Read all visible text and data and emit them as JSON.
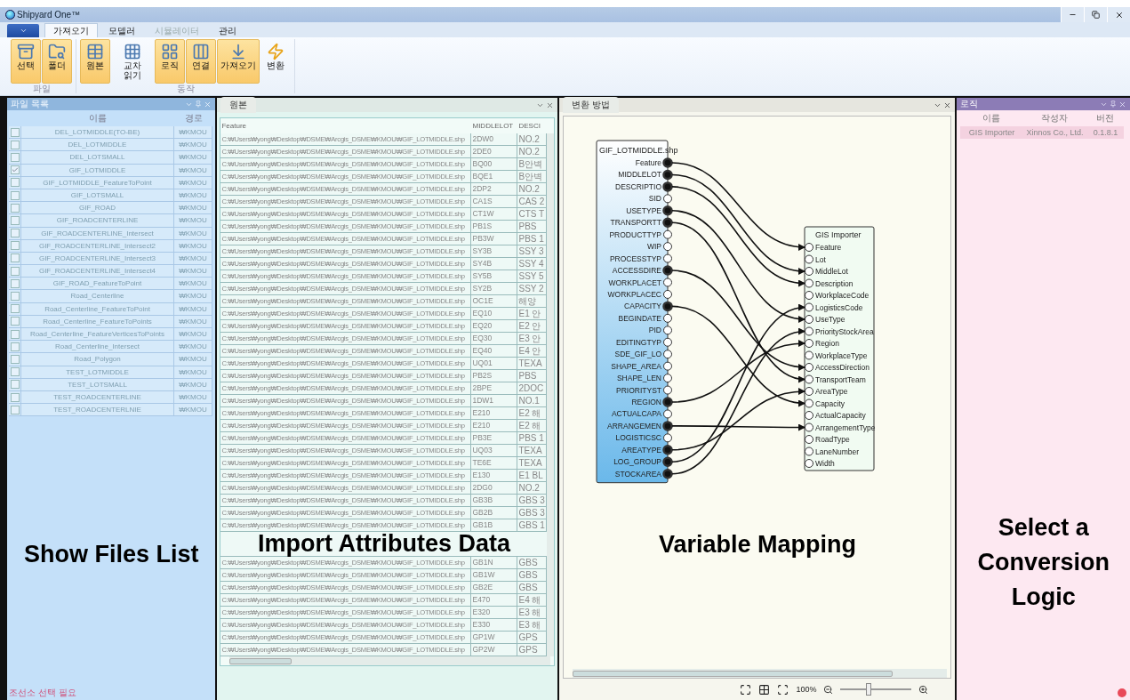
{
  "window": {
    "title": "Shipyard One™"
  },
  "tabs": [
    {
      "label": "가져오기",
      "selected": true,
      "disabled": false
    },
    {
      "label": "모델러",
      "selected": false,
      "disabled": false
    },
    {
      "label": "시뮬레이터",
      "selected": false,
      "disabled": true
    },
    {
      "label": "관리",
      "selected": false,
      "disabled": false
    }
  ],
  "ribbon": {
    "groups": [
      {
        "label": "파일",
        "buttons": [
          {
            "label": "선택",
            "active": true
          },
          {
            "label": "폴더",
            "active": true
          }
        ]
      },
      {
        "label": "동작",
        "buttons": [
          {
            "label": "원본",
            "active": true
          },
          {
            "label": "교차\n읽기",
            "active": false
          },
          {
            "label": "로직",
            "active": true
          },
          {
            "label": "연결",
            "active": true
          },
          {
            "label": "가져오기",
            "active": true
          },
          {
            "label": "변환",
            "active": false
          }
        ]
      }
    ]
  },
  "files_panel": {
    "title": "파일 목록",
    "columns": [
      "이름",
      "경로"
    ],
    "annotation": "Show Files List",
    "status": "조선소 선택 필요",
    "rows": [
      {
        "name": "DEL_LOTMIDDLE(TO-BE)",
        "path": "₩KMOU",
        "checked": false
      },
      {
        "name": "DEL_LOTMIDDLE",
        "path": "₩KMOU",
        "checked": false
      },
      {
        "name": "DEL_LOTSMALL",
        "path": "₩KMOU",
        "checked": false
      },
      {
        "name": "GIF_LOTMIDDLE",
        "path": "₩KMOU",
        "checked": true
      },
      {
        "name": "GIF_LOTMIDDLE_FeatureToPoint",
        "path": "₩KMOU",
        "checked": false
      },
      {
        "name": "GIF_LOTSMALL",
        "path": "₩KMOU",
        "checked": false
      },
      {
        "name": "GIF_ROAD",
        "path": "₩KMOU",
        "checked": false
      },
      {
        "name": "GIF_ROADCENTERLINE",
        "path": "₩KMOU",
        "checked": false
      },
      {
        "name": "GIF_ROADCENTERLINE_Intersect",
        "path": "₩KMOU",
        "checked": false
      },
      {
        "name": "GIF_ROADCENTERLINE_Intersect2",
        "path": "₩KMOU",
        "checked": false
      },
      {
        "name": "GIF_ROADCENTERLINE_Intersect3",
        "path": "₩KMOU",
        "checked": false
      },
      {
        "name": "GIF_ROADCENTERLINE_Intersect4",
        "path": "₩KMOU",
        "checked": false
      },
      {
        "name": "GIF_ROAD_FeatureToPoint",
        "path": "₩KMOU",
        "checked": false
      },
      {
        "name": "Road_Centerline",
        "path": "₩KMOU",
        "checked": false
      },
      {
        "name": "Road_Centerline_FeatureToPoint",
        "path": "₩KMOU",
        "checked": false
      },
      {
        "name": "Road_Centerline_FeatureToPoints",
        "path": "₩KMOU",
        "checked": false
      },
      {
        "name": "Road_Centerline_FeatureVerticesToPoints",
        "path": "₩KMOU",
        "checked": false
      },
      {
        "name": "Road_Centerline_Intersect",
        "path": "₩KMOU",
        "checked": false
      },
      {
        "name": "Road_Polygon",
        "path": "₩KMOU",
        "checked": false
      },
      {
        "name": "TEST_LOTMIDDLE",
        "path": "₩KMOU",
        "checked": false
      },
      {
        "name": "TEST_LOTSMALL",
        "path": "₩KMOU",
        "checked": false
      },
      {
        "name": "TEST_ROADCENTERLINE",
        "path": "₩KMOU",
        "checked": false
      },
      {
        "name": "TEST_ROADCENTERLNIE",
        "path": "₩KMOU",
        "checked": false
      }
    ]
  },
  "source_panel": {
    "title": "원본",
    "columns": [
      "Feature",
      "MIDDLELOT",
      "DESCI"
    ],
    "rows": [
      {
        "kind": "row",
        "cells": [
          "C:₩Users₩yong₩Desktop₩DSME₩Arcgis_DSME₩KMOU₩GIF_LOTMIDDLE.shp",
          "2DW0",
          "NO.2"
        ]
      },
      {
        "kind": "row",
        "cells": [
          "C:₩Users₩yong₩Desktop₩DSME₩Arcgis_DSME₩KMOU₩GIF_LOTMIDDLE.shp",
          "2DE0",
          "NO.2"
        ]
      },
      {
        "kind": "row",
        "cells": [
          "C:₩Users₩yong₩Desktop₩DSME₩Arcgis_DSME₩KMOU₩GIF_LOTMIDDLE.shp",
          "BQ00",
          "B안벽"
        ]
      },
      {
        "kind": "row",
        "cells": [
          "C:₩Users₩yong₩Desktop₩DSME₩Arcgis_DSME₩KMOU₩GIF_LOTMIDDLE.shp",
          "BQE1",
          "B안벽"
        ]
      },
      {
        "kind": "row",
        "cells": [
          "C:₩Users₩yong₩Desktop₩DSME₩Arcgis_DSME₩KMOU₩GIF_LOTMIDDLE.shp",
          "2DP2",
          "NO.2"
        ]
      },
      {
        "kind": "row",
        "cells": [
          "C:₩Users₩yong₩Desktop₩DSME₩Arcgis_DSME₩KMOU₩GIF_LOTMIDDLE.shp",
          "CA1S",
          "CAS 2"
        ]
      },
      {
        "kind": "row",
        "cells": [
          "C:₩Users₩yong₩Desktop₩DSME₩Arcgis_DSME₩KMOU₩GIF_LOTMIDDLE.shp",
          "CT1W",
          "CTS T"
        ]
      },
      {
        "kind": "row",
        "cells": [
          "C:₩Users₩yong₩Desktop₩DSME₩Arcgis_DSME₩KMOU₩GIF_LOTMIDDLE.shp",
          "PB1S",
          "PBS"
        ]
      },
      {
        "kind": "row",
        "cells": [
          "C:₩Users₩yong₩Desktop₩DSME₩Arcgis_DSME₩KMOU₩GIF_LOTMIDDLE.shp",
          "PB3W",
          "PBS 1"
        ]
      },
      {
        "kind": "row",
        "cells": [
          "C:₩Users₩yong₩Desktop₩DSME₩Arcgis_DSME₩KMOU₩GIF_LOTMIDDLE.shp",
          "SY3B",
          "SSY 3"
        ]
      },
      {
        "kind": "row",
        "cells": [
          "C:₩Users₩yong₩Desktop₩DSME₩Arcgis_DSME₩KMOU₩GIF_LOTMIDDLE.shp",
          "SY4B",
          "SSY 4"
        ]
      },
      {
        "kind": "row",
        "cells": [
          "C:₩Users₩yong₩Desktop₩DSME₩Arcgis_DSME₩KMOU₩GIF_LOTMIDDLE.shp",
          "SY5B",
          "SSY 5"
        ]
      },
      {
        "kind": "row",
        "cells": [
          "C:₩Users₩yong₩Desktop₩DSME₩Arcgis_DSME₩KMOU₩GIF_LOTMIDDLE.shp",
          "SY2B",
          "SSY 2"
        ]
      },
      {
        "kind": "row",
        "cells": [
          "C:₩Users₩yong₩Desktop₩DSME₩Arcgis_DSME₩KMOU₩GIF_LOTMIDDLE.shp",
          "OC1E",
          "해양"
        ]
      },
      {
        "kind": "row",
        "cells": [
          "C:₩Users₩yong₩Desktop₩DSME₩Arcgis_DSME₩KMOU₩GIF_LOTMIDDLE.shp",
          "EQ10",
          "E1 안"
        ]
      },
      {
        "kind": "row",
        "cells": [
          "C:₩Users₩yong₩Desktop₩DSME₩Arcgis_DSME₩KMOU₩GIF_LOTMIDDLE.shp",
          "EQ20",
          "E2 안"
        ]
      },
      {
        "kind": "row",
        "cells": [
          "C:₩Users₩yong₩Desktop₩DSME₩Arcgis_DSME₩KMOU₩GIF_LOTMIDDLE.shp",
          "EQ30",
          "E3 안"
        ]
      },
      {
        "kind": "row",
        "cells": [
          "C:₩Users₩yong₩Desktop₩DSME₩Arcgis_DSME₩KMOU₩GIF_LOTMIDDLE.shp",
          "EQ40",
          "E4 안"
        ]
      },
      {
        "kind": "row",
        "cells": [
          "C:₩Users₩yong₩Desktop₩DSME₩Arcgis_DSME₩KMOU₩GIF_LOTMIDDLE.shp",
          "UQ01",
          "TEXA"
        ]
      },
      {
        "kind": "row",
        "cells": [
          "C:₩Users₩yong₩Desktop₩DSME₩Arcgis_DSME₩KMOU₩GIF_LOTMIDDLE.shp",
          "PB2S",
          "PBS"
        ]
      },
      {
        "kind": "row",
        "cells": [
          "C:₩Users₩yong₩Desktop₩DSME₩Arcgis_DSME₩KMOU₩GIF_LOTMIDDLE.shp",
          "2BPE",
          "2DOC"
        ]
      },
      {
        "kind": "row",
        "cells": [
          "C:₩Users₩yong₩Desktop₩DSME₩Arcgis_DSME₩KMOU₩GIF_LOTMIDDLE.shp",
          "1DW1",
          "NO.1"
        ]
      },
      {
        "kind": "row",
        "cells": [
          "C:₩Users₩yong₩Desktop₩DSME₩Arcgis_DSME₩KMOU₩GIF_LOTMIDDLE.shp",
          "E210",
          "E2 해"
        ]
      },
      {
        "kind": "row",
        "cells": [
          "C:₩Users₩yong₩Desktop₩DSME₩Arcgis_DSME₩KMOU₩GIF_LOTMIDDLE.shp",
          "E210",
          "E2 해"
        ]
      },
      {
        "kind": "row",
        "cells": [
          "C:₩Users₩yong₩Desktop₩DSME₩Arcgis_DSME₩KMOU₩GIF_LOTMIDDLE.shp",
          "PB3E",
          "PBS 1"
        ]
      },
      {
        "kind": "row",
        "cells": [
          "C:₩Users₩yong₩Desktop₩DSME₩Arcgis_DSME₩KMOU₩GIF_LOTMIDDLE.shp",
          "UQ03",
          "TEXA"
        ]
      },
      {
        "kind": "row",
        "cells": [
          "C:₩Users₩yong₩Desktop₩DSME₩Arcgis_DSME₩KMOU₩GIF_LOTMIDDLE.shp",
          "TE6E",
          "TEXA"
        ]
      },
      {
        "kind": "row",
        "cells": [
          "C:₩Users₩yong₩Desktop₩DSME₩Arcgis_DSME₩KMOU₩GIF_LOTMIDDLE.shp",
          "E130",
          "E1 BL"
        ]
      },
      {
        "kind": "row",
        "cells": [
          "C:₩Users₩yong₩Desktop₩DSME₩Arcgis_DSME₩KMOU₩GIF_LOTMIDDLE.shp",
          "2DG0",
          "NO.2"
        ]
      },
      {
        "kind": "row",
        "cells": [
          "C:₩Users₩yong₩Desktop₩DSME₩Arcgis_DSME₩KMOU₩GIF_LOTMIDDLE.shp",
          "GB3B",
          "GBS 3"
        ]
      },
      {
        "kind": "row",
        "cells": [
          "C:₩Users₩yong₩Desktop₩DSME₩Arcgis_DSME₩KMOU₩GIF_LOTMIDDLE.shp",
          "GB2B",
          "GBS 3"
        ]
      },
      {
        "kind": "row",
        "cells": [
          "C:₩Users₩yong₩Desktop₩DSME₩Arcgis_DSME₩KMOU₩GIF_LOTMIDDLE.shp",
          "GB1B",
          "GBS 1"
        ]
      },
      {
        "kind": "annotation",
        "text": "Import Attributes Data"
      },
      {
        "kind": "row",
        "cells": [
          "C:₩Users₩yong₩Desktop₩DSME₩Arcgis_DSME₩KMOU₩GIF_LOTMIDDLE.shp",
          "GB1N",
          "GBS"
        ]
      },
      {
        "kind": "row",
        "cells": [
          "C:₩Users₩yong₩Desktop₩DSME₩Arcgis_DSME₩KMOU₩GIF_LOTMIDDLE.shp",
          "GB1W",
          "GBS"
        ]
      },
      {
        "kind": "row",
        "cells": [
          "C:₩Users₩yong₩Desktop₩DSME₩Arcgis_DSME₩KMOU₩GIF_LOTMIDDLE.shp",
          "GB2E",
          "GBS"
        ]
      },
      {
        "kind": "row",
        "cells": [
          "C:₩Users₩yong₩Desktop₩DSME₩Arcgis_DSME₩KMOU₩GIF_LOTMIDDLE.shp",
          "E470",
          "E4 해"
        ]
      },
      {
        "kind": "row",
        "cells": [
          "C:₩Users₩yong₩Desktop₩DSME₩Arcgis_DSME₩KMOU₩GIF_LOTMIDDLE.shp",
          "E320",
          "E3 해"
        ]
      },
      {
        "kind": "row",
        "cells": [
          "C:₩Users₩yong₩Desktop₩DSME₩Arcgis_DSME₩KMOU₩GIF_LOTMIDDLE.shp",
          "E330",
          "E3 해"
        ]
      },
      {
        "kind": "row",
        "cells": [
          "C:₩Users₩yong₩Desktop₩DSME₩Arcgis_DSME₩KMOU₩GIF_LOTMIDDLE.shp",
          "GP1W",
          "GPS"
        ]
      },
      {
        "kind": "row",
        "cells": [
          "C:₩Users₩yong₩Desktop₩DSME₩Arcgis_DSME₩KMOU₩GIF_LOTMIDDLE.shp",
          "GP2W",
          "GPS"
        ]
      }
    ]
  },
  "mapping_panel": {
    "title": "변환 방법",
    "annotation": "Variable Mapping",
    "zoom": "100%",
    "zoom_level": {
      "level": 0.4
    },
    "source": {
      "title": "GIF_LOTMIDDLE.shp",
      "fields": [
        {
          "name": "Feature",
          "connected": true
        },
        {
          "name": "MIDDLELOT",
          "connected": true
        },
        {
          "name": "DESCRIPTIO",
          "connected": true
        },
        {
          "name": "SID",
          "connected": false
        },
        {
          "name": "USETYPE",
          "connected": true
        },
        {
          "name": "TRANSPORTT",
          "connected": true
        },
        {
          "name": "PRODUCTTYP",
          "connected": false
        },
        {
          "name": "WIP",
          "connected": false
        },
        {
          "name": "PROCESSTYP",
          "connected": false
        },
        {
          "name": "ACCESSDIRE",
          "connected": true
        },
        {
          "name": "WORKPLACET",
          "connected": false
        },
        {
          "name": "WORKPLACEC",
          "connected": false
        },
        {
          "name": "CAPACITY",
          "connected": true
        },
        {
          "name": "BEGINDATE",
          "connected": false
        },
        {
          "name": "PID",
          "connected": false
        },
        {
          "name": "EDITINGTYP",
          "connected": false
        },
        {
          "name": "SDE_GIF_LO",
          "connected": false
        },
        {
          "name": "SHAPE_AREA",
          "connected": false
        },
        {
          "name": "SHAPE_LEN",
          "connected": false
        },
        {
          "name": "PRIORITYST",
          "connected": false
        },
        {
          "name": "REGION",
          "connected": true
        },
        {
          "name": "ACTUALCAPA",
          "connected": false
        },
        {
          "name": "ARRANGEMEN",
          "connected": true
        },
        {
          "name": "LOGISTICSC",
          "connected": false
        },
        {
          "name": "AREATYPE",
          "connected": true
        },
        {
          "name": "LOG_GROUP",
          "connected": true
        },
        {
          "name": "STOCKAREA",
          "connected": true
        }
      ]
    },
    "target": {
      "title": "GIS Importer",
      "fields": [
        "Feature",
        "Lot",
        "MiddleLot",
        "Description",
        "WorkplaceCode",
        "LogisticsCode",
        "UseType",
        "PriorityStockArea",
        "Region",
        "WorkplaceType",
        "AccessDirection",
        "TransportTeam",
        "AreaType",
        "Capacity",
        "ActualCapacity",
        "ArrangementType",
        "RoadType",
        "LaneNumber",
        "Width"
      ]
    }
  },
  "logic_panel": {
    "title": "로직",
    "columns": [
      "이름",
      "작성자",
      "버전"
    ],
    "annotation": "Select a Conversion Logic",
    "rows": [
      {
        "name": "GIS Importer",
        "author": "Xinnos Co., Ltd.",
        "version": "0.1.8.1",
        "selected": true
      }
    ]
  }
}
